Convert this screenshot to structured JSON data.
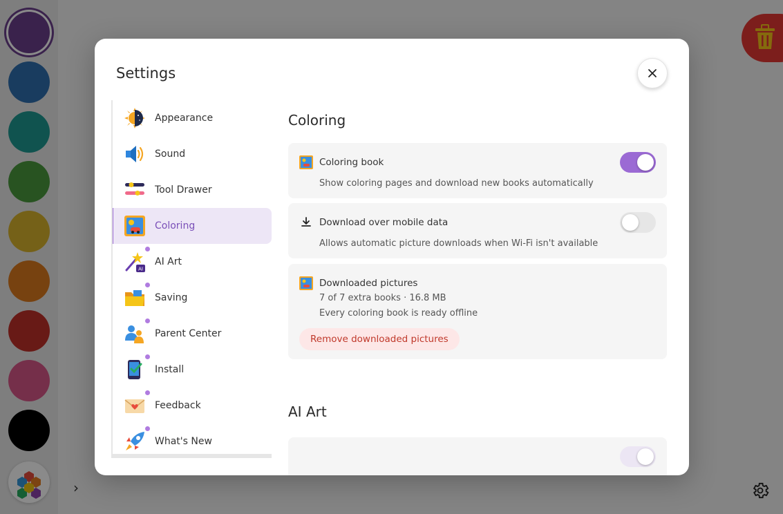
{
  "dialog": {
    "title": "Settings",
    "close_label": "×"
  },
  "palette": {
    "colors": [
      "#6b3f8c",
      "#2f6fb0",
      "#1f9a93",
      "#4a9a3e",
      "#d9b42e",
      "#dd7a1e",
      "#c0302a",
      "#d9578a",
      "#000000"
    ],
    "selected_index": 0
  },
  "nav": {
    "items": [
      {
        "label": "Appearance",
        "icon": "sun-moon-icon",
        "dot": false
      },
      {
        "label": "Sound",
        "icon": "speaker-icon",
        "dot": false
      },
      {
        "label": "Tool Drawer",
        "icon": "sliders-icon",
        "dot": false
      },
      {
        "label": "Coloring",
        "icon": "coloring-book-icon",
        "dot": false,
        "active": true
      },
      {
        "label": "AI Art",
        "icon": "magic-wand-icon",
        "dot": true
      },
      {
        "label": "Saving",
        "icon": "folder-icon",
        "dot": true
      },
      {
        "label": "Parent Center",
        "icon": "parents-icon",
        "dot": true
      },
      {
        "label": "Install",
        "icon": "phone-check-icon",
        "dot": true
      },
      {
        "label": "Feedback",
        "icon": "envelope-heart-icon",
        "dot": true
      },
      {
        "label": "What's New",
        "icon": "rocket-icon",
        "dot": true
      }
    ]
  },
  "coloring": {
    "heading": "Coloring",
    "coloring_book": {
      "title": "Coloring book",
      "desc": "Show coloring pages and download new books automatically",
      "enabled": true
    },
    "mobile_data": {
      "title": "Download over mobile data",
      "desc": "Allows automatic picture downloads when Wi-Fi isn't available",
      "enabled": false
    },
    "downloaded": {
      "title": "Downloaded pictures",
      "count": "7 of 7 extra books · 16.8 MB",
      "status": "Every coloring book is ready offline",
      "button": "Remove downloaded pictures"
    }
  },
  "ai_art": {
    "heading": "AI Art"
  }
}
